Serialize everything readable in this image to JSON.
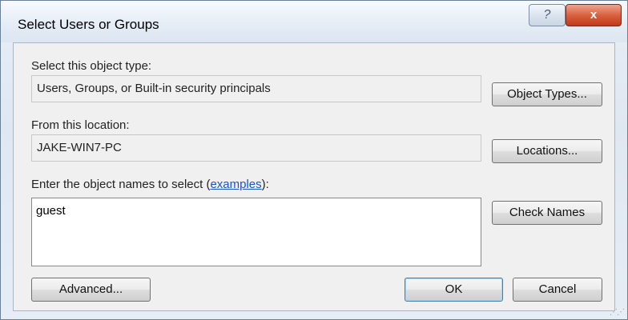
{
  "window": {
    "title": "Select Users or Groups",
    "help_label": "?",
    "close_label": "x"
  },
  "object_type": {
    "label": "Select this object type:",
    "value": "Users, Groups, or Built-in security principals",
    "button": "Object Types..."
  },
  "location": {
    "label": "From this location:",
    "value": "JAKE-WIN7-PC",
    "button": "Locations..."
  },
  "names": {
    "label_prefix": "Enter the object names to select (",
    "link": "examples",
    "label_suffix": "):",
    "value": "guest",
    "check_button": "Check Names"
  },
  "footer": {
    "advanced": "Advanced...",
    "ok": "OK",
    "cancel": "Cancel"
  }
}
